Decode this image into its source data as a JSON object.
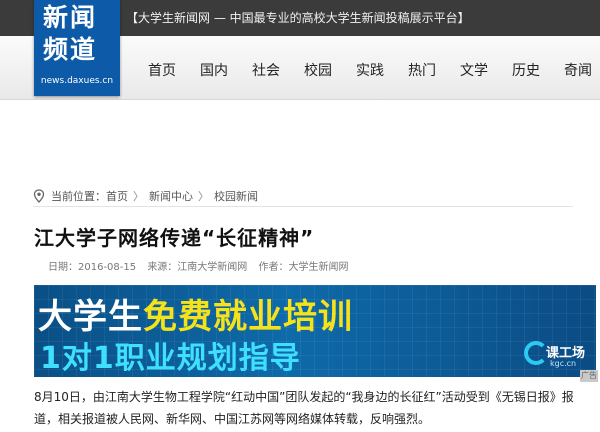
{
  "header": {
    "slogan": "【大学生新闻网 — 中国最专业的高校大学生新闻投稿展示平台】",
    "logo": {
      "line1": "新闻",
      "line2": "频道",
      "url": "news.daxues.cn"
    }
  },
  "nav": {
    "items": [
      {
        "label": "首页"
      },
      {
        "label": "国内"
      },
      {
        "label": "社会"
      },
      {
        "label": "校园"
      },
      {
        "label": "实践"
      },
      {
        "label": "热门"
      },
      {
        "label": "文学"
      },
      {
        "label": "历史"
      },
      {
        "label": "奇闻"
      }
    ]
  },
  "breadcrumb": {
    "prefix": "当前位置：",
    "items": [
      "首页",
      "新闻中心",
      "校园新闻"
    ],
    "separator": "〉"
  },
  "article": {
    "title": "江大学子网络传递“长征精神”",
    "date": "日期：2016-08-15",
    "source": "来源：江南大学新闻网",
    "author": "作者：大学生新闻网",
    "body": "8月10日，由江南大学生物工程学院“红动中国”团队发起的“我身边的长征红”活动受到《无锡日报》报道，相关报道被人民网、新华网、中国江苏网等网络媒体转载，反响强烈。"
  },
  "banner": {
    "line1_white": "大学生",
    "line1_yellow": "免费就业培训",
    "line2": "1对1职业规划指导",
    "brand_name": "课工场",
    "brand_domain": "kgc.cn",
    "ad_label": "广告"
  },
  "colors": {
    "topbar": "#3b3b3b",
    "logo_blue": "#0c5aa8",
    "banner_yellow": "#f6e21b",
    "banner_cyan": "#3fe0ff"
  }
}
